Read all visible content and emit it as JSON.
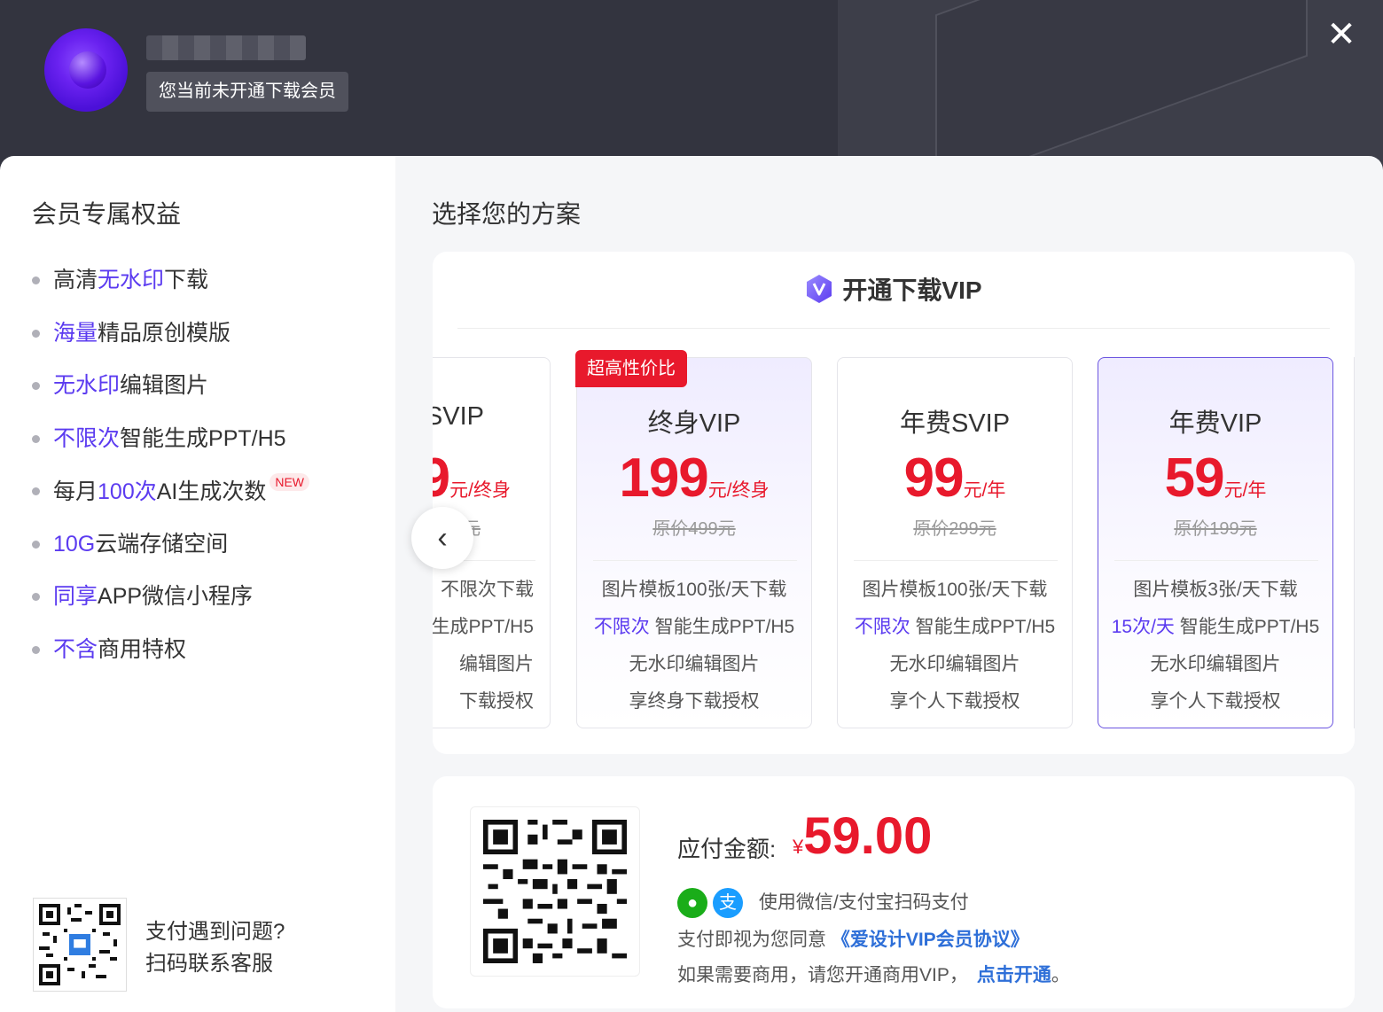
{
  "header": {
    "member_status": "您当前未开通下载会员",
    "close_icon": "✕"
  },
  "left": {
    "title": "会员专属权益",
    "benefits": [
      {
        "hl": "",
        "pre": "高清",
        "em": "无水印",
        "post": "下载"
      },
      {
        "pre": "",
        "em": "海量",
        "post": "精品原创模版"
      },
      {
        "pre": "",
        "em": "无水印",
        "post": "编辑图片"
      },
      {
        "pre": "",
        "em": "不限次",
        "post": "智能生成PPT/H5"
      },
      {
        "pre": "每月",
        "em": "100次",
        "post": "AI生成次数",
        "tag": "NEW"
      },
      {
        "pre": "",
        "em": "10G",
        "post": "云端存储空间"
      },
      {
        "pre": "",
        "em": "同享",
        "post": "APP微信小程序"
      },
      {
        "pre": "",
        "em": "不含",
        "post": "商用特权"
      }
    ],
    "service_line1": "支付遇到问题?",
    "service_line2": "扫码联系客服"
  },
  "right": {
    "title": "选择您的方案",
    "plans_header": "开通下载VIP",
    "plans": [
      {
        "name": "SVIP",
        "price": "9",
        "unit": "元/终身",
        "orig": "元",
        "feats": [
          "不限次下载",
          "生成PPT/H5",
          "编辑图片",
          "下载授权"
        ]
      },
      {
        "name": "终身VIP",
        "badge": "超高性价比",
        "price": "199",
        "unit": "元/终身",
        "orig": "原价499元",
        "feats": [
          "图片模板100张/天下载",
          "不限次| 智能生成PPT/H5",
          "无水印编辑图片",
          "享终身下载授权"
        ]
      },
      {
        "name": "年费SVIP",
        "price": "99",
        "unit": "元/年",
        "orig": "原价299元",
        "feats": [
          "图片模板100张/天下载",
          "不限次| 智能生成PPT/H5",
          "无水印编辑图片",
          "享个人下载授权"
        ]
      },
      {
        "name": "年费VIP",
        "price": "59",
        "unit": "元/年",
        "orig": "原价199元",
        "feats": [
          "图片模板3张/天下载",
          "15次/天| 智能生成PPT/H5",
          "无水印编辑图片",
          "享个人下载授权"
        ]
      }
    ],
    "prev_icon": "‹",
    "pay": {
      "amount_label": "应付金额:",
      "currency": "¥",
      "amount": "59.00",
      "methods_text": "使用微信/支付宝扫码支付",
      "agree_pre": "支付即视为您同意",
      "agree_link": "《爱设计VIP会员协议》",
      "commercial_pre": "如果需要商用，请您开通商用VIP，",
      "commercial_link": "点击开通",
      "commercial_post": "。"
    }
  },
  "colors": {
    "accent": "#5b3bf0",
    "price": "#e8192c",
    "link": "#2e6fd8"
  }
}
